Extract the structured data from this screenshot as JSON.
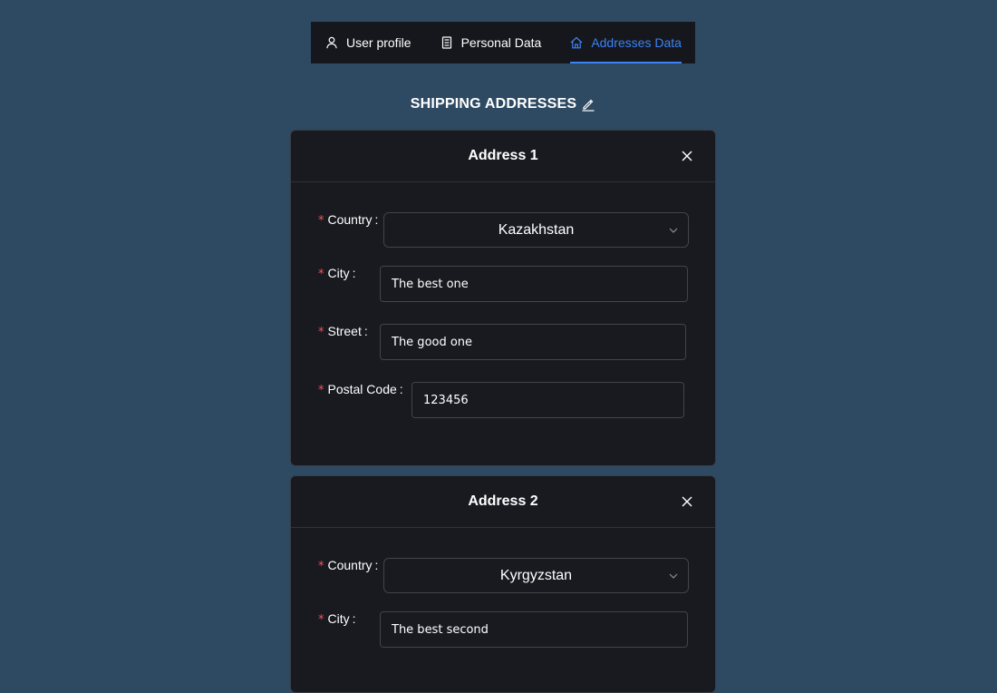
{
  "tabs": [
    {
      "label": "User profile",
      "icon": "user-icon",
      "active": false
    },
    {
      "label": "Personal Data",
      "icon": "document-icon",
      "active": false
    },
    {
      "label": "Addresses Data",
      "icon": "home-icon",
      "active": true
    }
  ],
  "section": {
    "title": "SHIPPING ADDRESSES",
    "edit_icon": "edit-pencil-icon"
  },
  "addresses": [
    {
      "title": "Address 1",
      "country": {
        "label": "Country",
        "value": "Kazakhstan"
      },
      "city": {
        "label": "City",
        "value": "The best one"
      },
      "street": {
        "label": "Street",
        "value": "The good one"
      },
      "postal_code": {
        "label": "Postal Code",
        "value": "123456"
      }
    },
    {
      "title": "Address 2",
      "country": {
        "label": "Country",
        "value": "Kyrgyzstan"
      },
      "city": {
        "label": "City",
        "value": "The best second"
      }
    }
  ],
  "required_mark": "*",
  "colon": ":",
  "colors": {
    "background": "#2e4a63",
    "panel": "#181a20",
    "accent": "#3b82f6",
    "required": "#ff4d4f"
  }
}
